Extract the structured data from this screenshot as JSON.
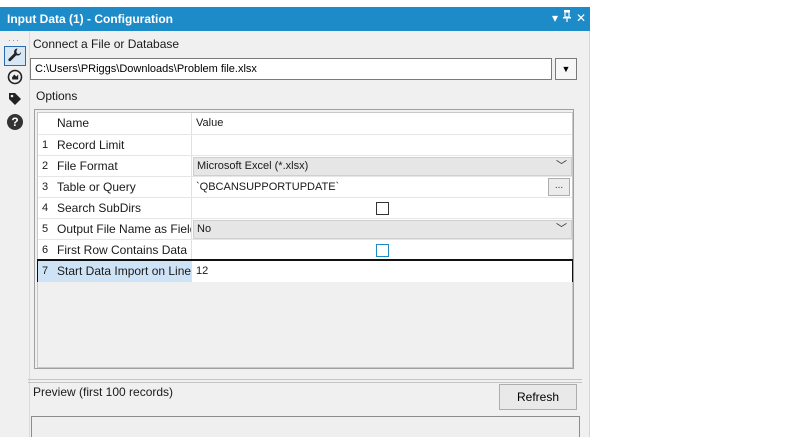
{
  "window": {
    "title": "Input Data (1) - Configuration",
    "icons": {
      "menu": "chevron-down-icon",
      "pin": "pin-icon",
      "close": "close-icon"
    }
  },
  "toolbar": {
    "tools": [
      {
        "name": "configuration",
        "icon": "wrench-icon",
        "active": true
      },
      {
        "name": "annotation",
        "icon": "annotation-icon"
      },
      {
        "name": "metadata",
        "icon": "tag-icon"
      },
      {
        "name": "help",
        "icon": "help-icon",
        "glyph": "?"
      }
    ]
  },
  "connect": {
    "label": "Connect a File or Database",
    "path": "C:\\Users\\PRiggs\\Downloads\\Problem file.xlsx"
  },
  "options": {
    "label": "Options",
    "columns": {
      "name": "Name",
      "value": "Value"
    },
    "rows": [
      {
        "num": "1",
        "name": "Record Limit",
        "value": ""
      },
      {
        "num": "2",
        "name": "File Format",
        "value": "Microsoft Excel (*.xlsx)"
      },
      {
        "num": "3",
        "name": "Table or Query",
        "value": "`QBCANSUPPORTUPDATE`",
        "button": "..."
      },
      {
        "num": "4",
        "name": "Search SubDirs",
        "checked": false
      },
      {
        "num": "5",
        "name": "Output File Name as Field",
        "value": "No"
      },
      {
        "num": "6",
        "name": "First Row Contains Data",
        "checked": false
      },
      {
        "num": "7",
        "name": "Start Data Import on Line",
        "value": "12"
      }
    ]
  },
  "preview": {
    "label": "Preview (first 100 records)",
    "refresh_label": "Refresh"
  },
  "colors": {
    "titlebar": "#1e8bc9",
    "selected_row": "#cfe3f7",
    "panel_bg": "#f0f0f0"
  }
}
